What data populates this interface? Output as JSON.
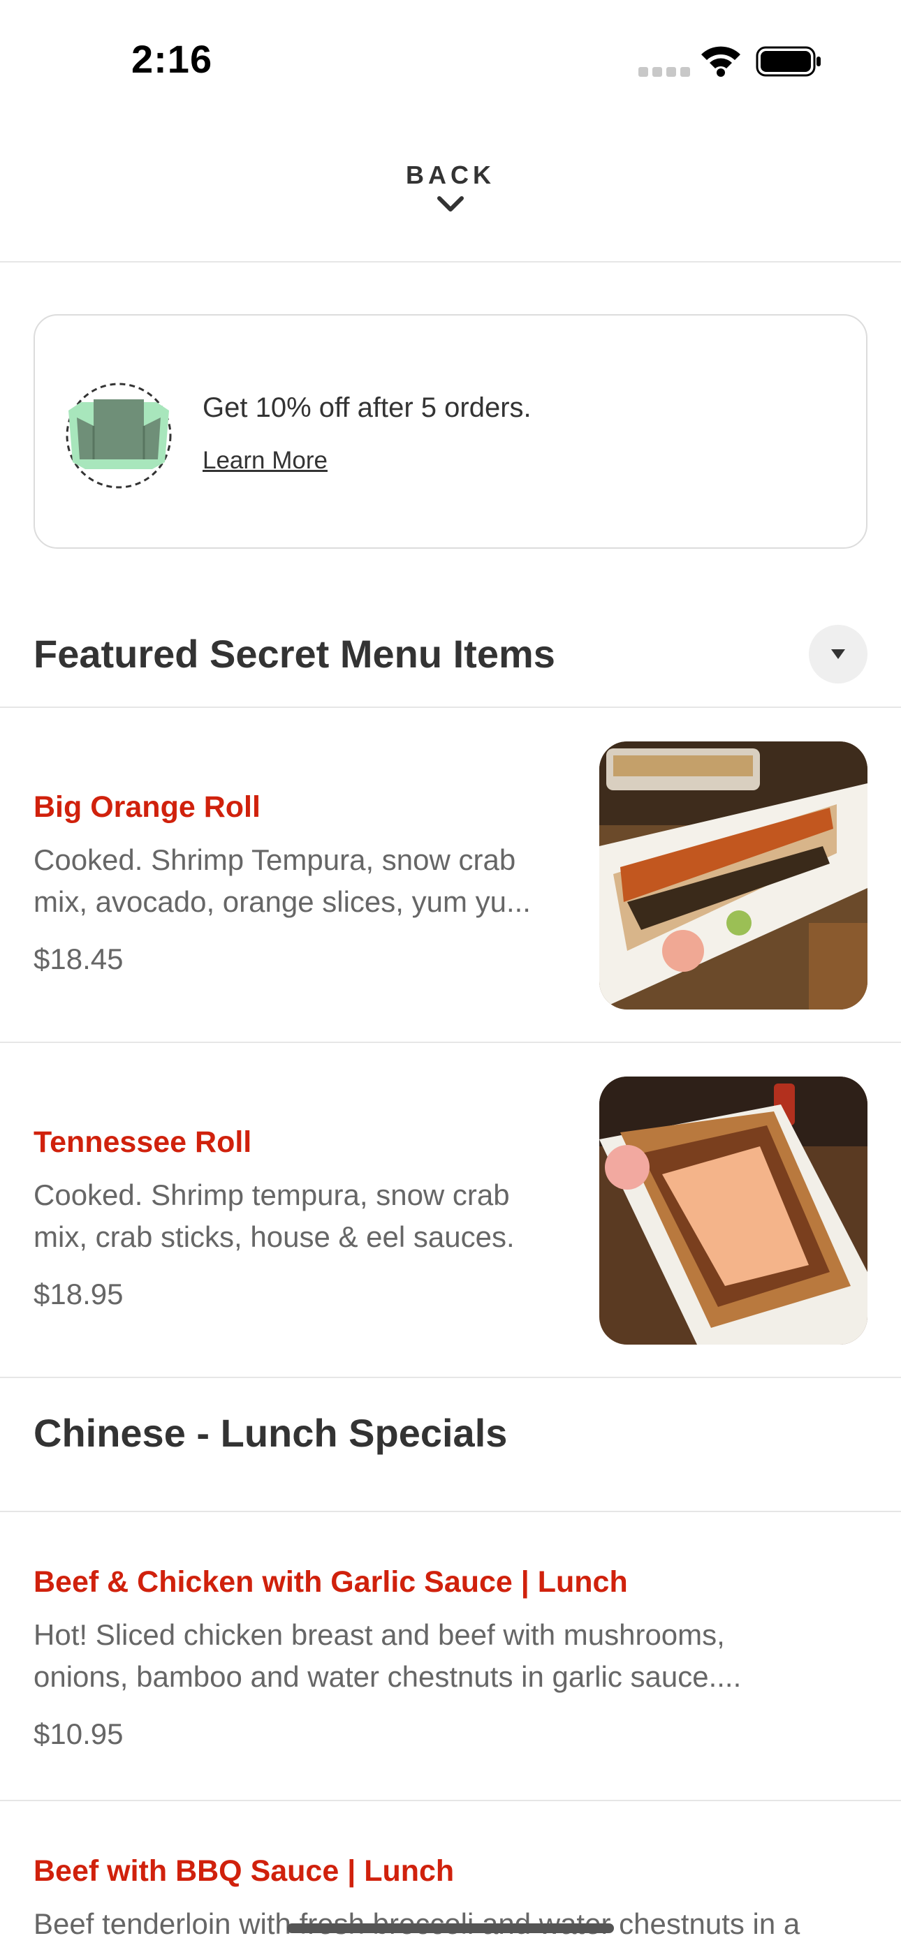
{
  "status_bar": {
    "time": "2:16",
    "icons": [
      "cellular-signal-icon",
      "wifi-icon",
      "battery-icon"
    ]
  },
  "header": {
    "back_label": "BACK",
    "chevron_icon": "chevron-down-icon"
  },
  "rewards": {
    "text": "Get 10% off after 5 orders.",
    "link": "Learn More",
    "icon": "takeout-box-icon"
  },
  "sections": [
    {
      "title": "Featured Secret Menu Items",
      "collapse_icon": "caret-down-icon",
      "items": [
        {
          "name": "Big Orange Roll",
          "desc_lines": [
            "Cooked. Shrimp Tempura, snow crab",
            "mix, avocado, orange slices, yum yu..."
          ],
          "price": "$18.45"
        },
        {
          "name": "Tennessee Roll",
          "desc_lines": [
            "Cooked. Shrimp tempura, snow crab",
            "mix, crab sticks, house & eel sauces."
          ],
          "price": "$18.95"
        }
      ]
    },
    {
      "title": "Chinese - Lunch Specials",
      "items": [
        {
          "name": "Beef & Chicken with Garlic Sauce | Lunch",
          "desc_lines": [
            "Hot! Sliced chicken breast and beef with mushrooms,",
            "onions, bamboo and water chestnuts in garlic sauce...."
          ],
          "price": "$10.95"
        },
        {
          "name": "Beef with BBQ Sauce | Lunch",
          "desc_lines": [
            "Beef tenderloin with fresh broccoli and water chestnuts in a"
          ]
        }
      ]
    }
  ],
  "colors": {
    "accent": "#d0210c",
    "text": "#333333",
    "muted": "#666666",
    "divider": "#e6e6e6",
    "rewards_green": "#a8e6bc"
  }
}
